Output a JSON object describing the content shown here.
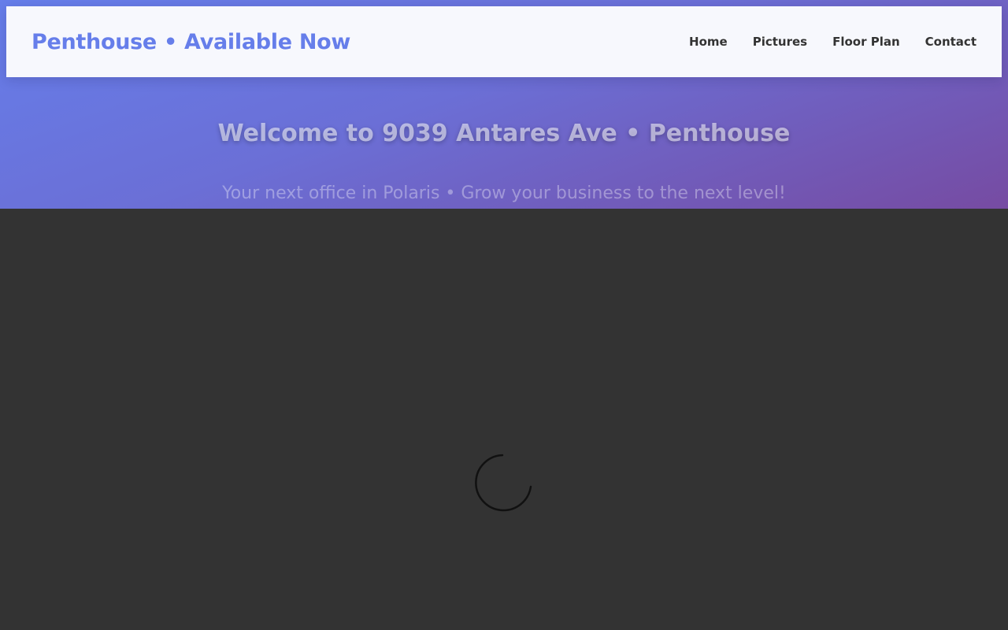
{
  "navbar": {
    "brand": "Penthouse • Available Now",
    "links": [
      {
        "label": "Home"
      },
      {
        "label": "Pictures"
      },
      {
        "label": "Floor Plan"
      },
      {
        "label": "Contact"
      }
    ]
  },
  "hero": {
    "title": "Welcome to 9039 Antares Ave • Penthouse",
    "subtitle": "Your next office in Polaris • Grow your business to the next level!"
  },
  "loader": {
    "icon": "spinner-icon",
    "color": "#111111"
  },
  "colors": {
    "accent": "#667eea",
    "gradient_start": "#667eea",
    "gradient_end": "#764ba2",
    "overlay": "#333333",
    "nav_text": "#333333"
  }
}
